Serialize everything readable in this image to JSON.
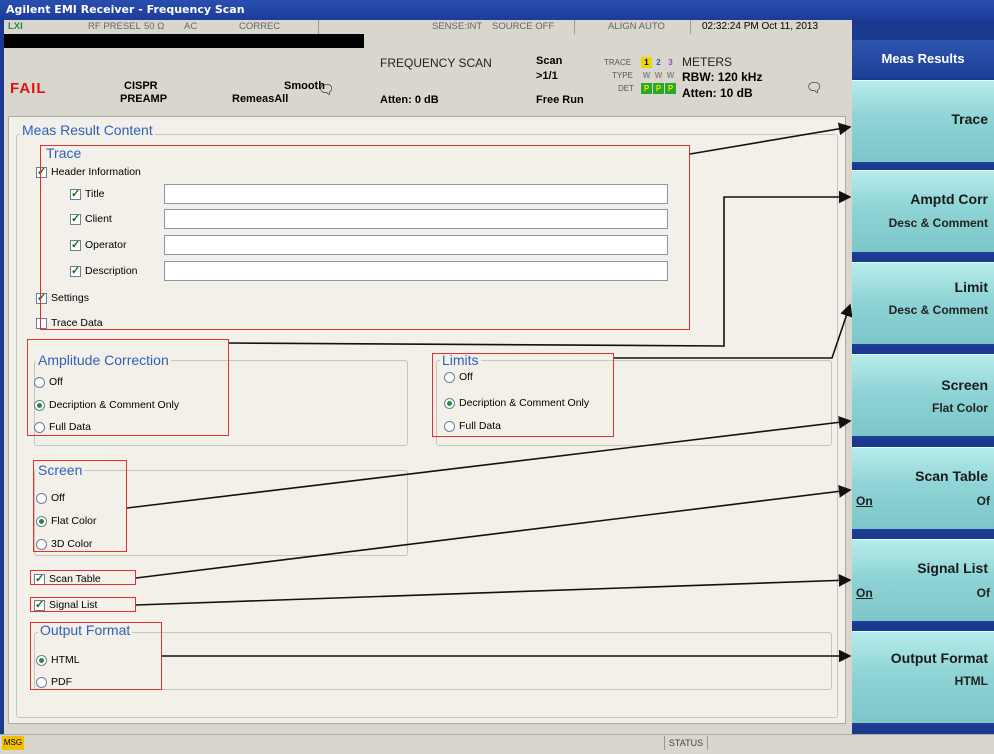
{
  "window": {
    "title": "Agilent EMI Receiver - Frequency Scan"
  },
  "status_header": {
    "lxi": "LXI",
    "rf_presel": "RF PRESEL",
    "impedance": "50 Ω",
    "coupling": "AC",
    "correc": "CORREC",
    "sense": "SENSE:INT",
    "source": "SOURCE OFF",
    "align": "ALIGN AUTO",
    "datetime": "02:32:24 PM Oct 11, 2013"
  },
  "meas_header": {
    "fail": "FAIL",
    "cispr": "CISPR",
    "preamp": "PREAMP",
    "smooth": "Smooth",
    "remeas": "RemeasAll",
    "mode": "FREQUENCY SCAN",
    "atten_left": "Atten: 0 dB",
    "scan": "Scan",
    "scan_count": ">1/1",
    "run": "Free Run",
    "trace_label": "TRACE",
    "type_label": "TYPE",
    "det_label": "DET",
    "trace_nums": [
      "1",
      "2",
      "3"
    ],
    "type_vals": [
      "W",
      "W",
      "W"
    ],
    "det_vals": [
      "P",
      "P",
      "P"
    ],
    "meters": "METERS",
    "rbw": "RBW: 120 kHz",
    "atten_right": "Atten: 10 dB"
  },
  "content": {
    "group_title": "Meas Result Content",
    "trace": {
      "title": "Trace",
      "header_info": "Header Information",
      "fields": [
        {
          "label": "Title",
          "value": ""
        },
        {
          "label": "Client",
          "value": ""
        },
        {
          "label": "Operator",
          "value": ""
        },
        {
          "label": "Description",
          "value": ""
        }
      ],
      "settings": "Settings",
      "trace_data": "Trace Data"
    },
    "amplitude_correction": {
      "title": "Amplitude Correction",
      "options": [
        "Off",
        "Decription & Comment Only",
        "Full Data"
      ],
      "selected": 1
    },
    "limits": {
      "title": "Limits",
      "options": [
        "Off",
        "Decription & Comment Only",
        "Full Data"
      ],
      "selected": 1
    },
    "screen": {
      "title": "Screen",
      "options": [
        "Off",
        "Flat Color",
        "3D Color"
      ],
      "selected": 1
    },
    "scan_table": "Scan Table",
    "signal_list": "Signal List",
    "output_format": {
      "title": "Output Format",
      "options": [
        "HTML",
        "PDF"
      ],
      "selected": 0
    }
  },
  "softkeys": {
    "menu_title": "Meas Results",
    "keys": [
      {
        "label": "Trace",
        "sub": ""
      },
      {
        "label": "Amptd Corr",
        "sub": "Desc & Comment"
      },
      {
        "label": "Limit",
        "sub": "Desc & Comment"
      },
      {
        "label": "Screen",
        "sub": "Flat Color"
      },
      {
        "label": "Scan Table",
        "on": "On",
        "off": "Of"
      },
      {
        "label": "Signal List",
        "on": "On",
        "off": "Of"
      },
      {
        "label": "Output Format",
        "sub": "HTML"
      }
    ]
  },
  "status_bar": {
    "msg": "MSG",
    "status": "STATUS"
  },
  "colors": {
    "annotation_red": "#e03030",
    "softkey_cyan": "#8fd4d6",
    "title_blue": "#1d3f95",
    "fail_red": "#e01010"
  }
}
